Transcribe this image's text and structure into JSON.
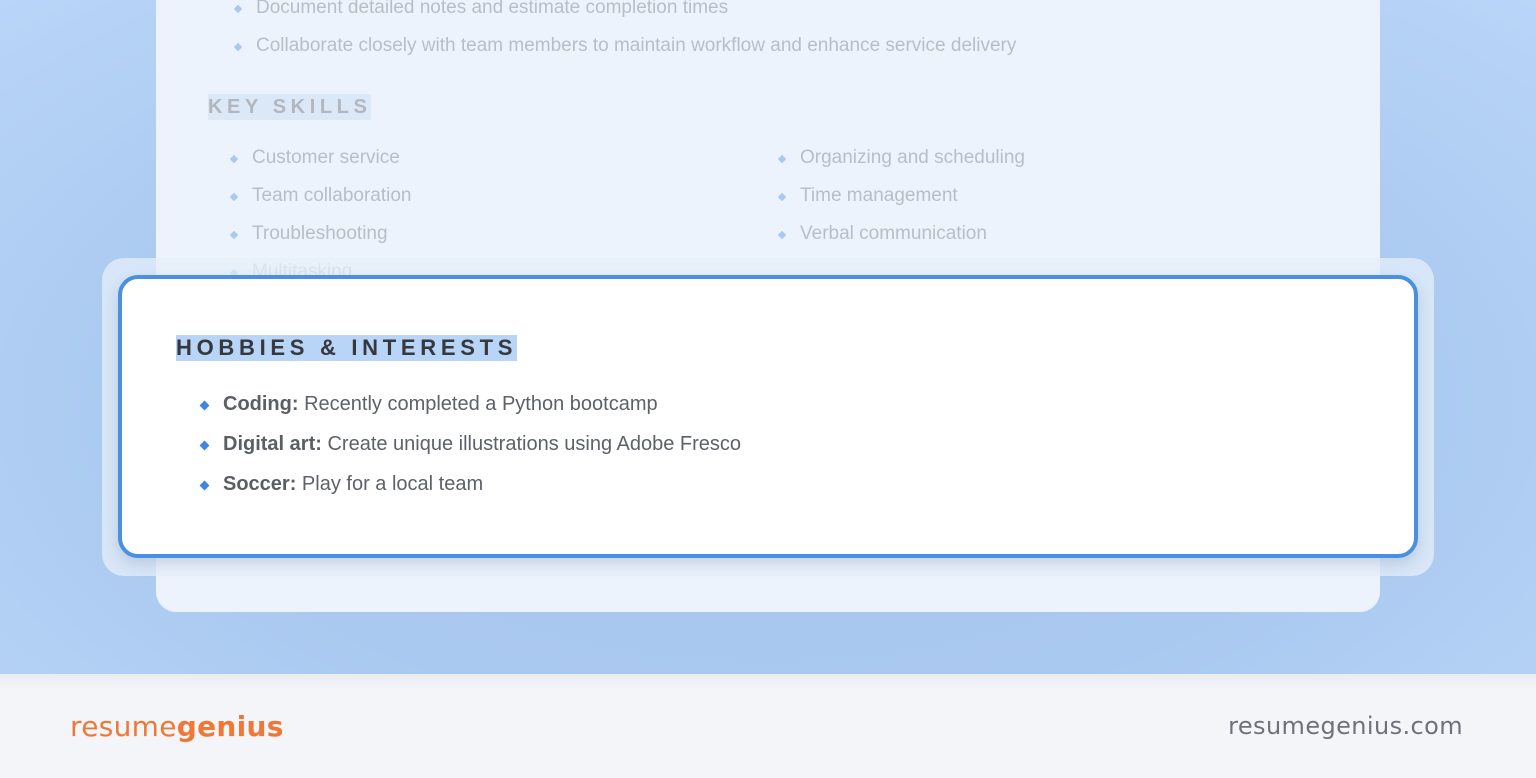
{
  "resume": {
    "experience_bullets": [
      "Document detailed notes and estimate completion times",
      "Collaborate closely with team members to maintain workflow and enhance service delivery"
    ],
    "key_skills_heading": "KEY SKILLS",
    "key_skills_left": [
      "Customer service",
      "Team collaboration",
      "Troubleshooting",
      "Multitasking"
    ],
    "key_skills_right": [
      "Organizing and scheduling",
      "Time management",
      "Verbal communication"
    ]
  },
  "hobbies": {
    "heading": "HOBBIES & INTERESTS",
    "items": [
      {
        "label": "Coding:",
        "text": " Recently completed a Python bootcamp"
      },
      {
        "label": "Digital art:",
        "text": " Create unique illustrations using Adobe Fresco"
      },
      {
        "label": "Soccer:",
        "text": " Play for a local team"
      }
    ]
  },
  "footer": {
    "logo_light": "resume",
    "logo_bold": "genius",
    "site": "resumegenius.com"
  },
  "colors": {
    "accent_blue": "#4a90e2",
    "brand_orange": "#f07837",
    "background_blue": "#aac9f0"
  }
}
